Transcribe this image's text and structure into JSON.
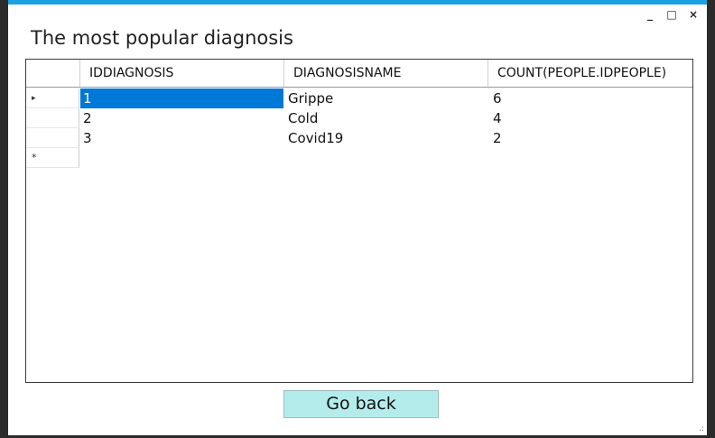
{
  "window": {
    "title": "The most popular diagnosis",
    "controls": {
      "minimize": "_",
      "maximize": "□",
      "close": "×"
    },
    "accent": "#1ba1e2"
  },
  "grid": {
    "columns": [
      "IDDIAGNOSIS",
      "DIAGNOSISNAME",
      "COUNT(PEOPLE.IDPEOPLE)"
    ],
    "rows": [
      {
        "marker": "▸",
        "cells": [
          "1",
          "Grippe",
          "6"
        ]
      },
      {
        "marker": "",
        "cells": [
          "2",
          "Cold",
          "4"
        ]
      },
      {
        "marker": "",
        "cells": [
          "3",
          "Covid19",
          "2"
        ]
      }
    ],
    "new_row_marker": "*",
    "selection_color": "#0078d7"
  },
  "actions": {
    "go_back_label": "Go back",
    "button_color": "#b4ecec"
  },
  "icons": {
    "current_row": "row-pointer-icon",
    "new_row": "new-row-icon",
    "resize": "resize-grip-icon"
  }
}
